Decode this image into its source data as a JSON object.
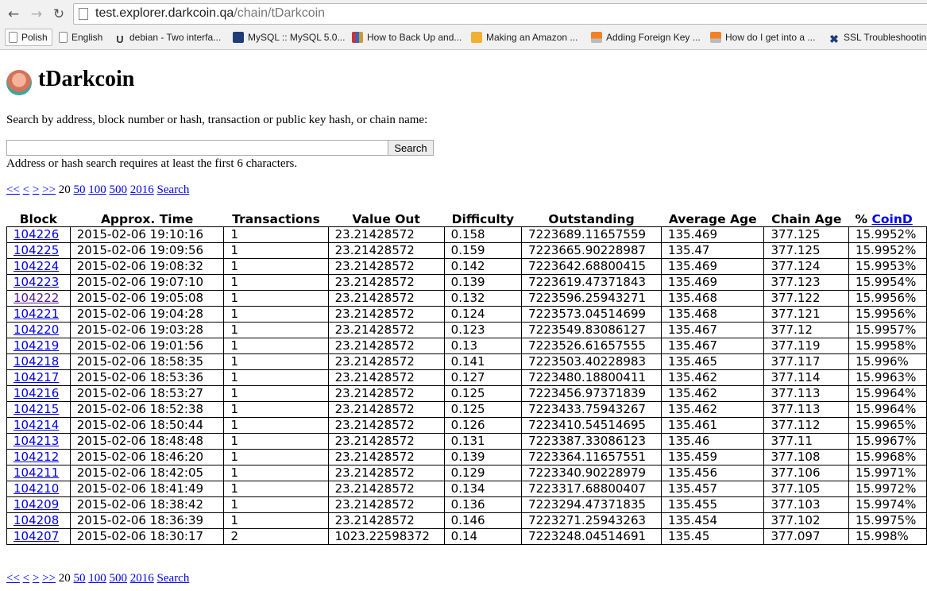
{
  "browser": {
    "url_host": "test.explorer.darkcoin.qa",
    "url_path": "/chain/tDarkcoin",
    "bookmarks": [
      {
        "label": "Polish",
        "icon": "document-icon"
      },
      {
        "label": "English",
        "icon": "document-icon"
      },
      {
        "label": "debian - Two interfa...",
        "icon": "ubuntu-icon"
      },
      {
        "label": "MySQL :: MySQL 5.0...",
        "icon": "mysql-icon"
      },
      {
        "label": "How to Back Up and...",
        "icon": "books-icon"
      },
      {
        "label": "Making an Amazon ...",
        "icon": "amazon-box-icon"
      },
      {
        "label": "Adding Foreign Key ...",
        "icon": "stackoverflow-icon"
      },
      {
        "label": "How do I get into a ...",
        "icon": "stackoverflow-icon"
      },
      {
        "label": "SSL Troubleshootin",
        "icon": "tools-icon"
      }
    ]
  },
  "page": {
    "title": "tDarkcoin",
    "search_description": "Search by address, block number or hash, transaction or public key hash, or chain name:",
    "search_input_value": "",
    "search_button": "Search",
    "search_hint": "Address or hash search requires at least the first 6 characters."
  },
  "pager": {
    "first": "<<",
    "prev": "<",
    "next": ">",
    "last": ">>",
    "current": "20",
    "sizes": [
      "50",
      "100",
      "500",
      "2016"
    ],
    "search": "Search"
  },
  "table": {
    "headers": [
      "Block",
      "Approx. Time",
      "Transactions",
      "Value Out",
      "Difficulty",
      "Outstanding",
      "Average Age",
      "Chain Age"
    ],
    "last_header_prefix": "% ",
    "last_header_link": "CoinD",
    "rows": [
      [
        "104226",
        "2015-02-06 19:10:16",
        "1",
        "23.21428572",
        "0.158",
        "7223689.11657559",
        "135.469",
        "377.125",
        "15.9952%"
      ],
      [
        "104225",
        "2015-02-06 19:09:56",
        "1",
        "23.21428572",
        "0.159",
        "7223665.90228987",
        "135.47",
        "377.125",
        "15.9952%"
      ],
      [
        "104224",
        "2015-02-06 19:08:32",
        "1",
        "23.21428572",
        "0.142",
        "7223642.68800415",
        "135.469",
        "377.124",
        "15.9953%"
      ],
      [
        "104223",
        "2015-02-06 19:07:10",
        "1",
        "23.21428572",
        "0.139",
        "7223619.47371843",
        "135.469",
        "377.123",
        "15.9954%"
      ],
      [
        "104222",
        "2015-02-06 19:05:08",
        "1",
        "23.21428572",
        "0.132",
        "7223596.25943271",
        "135.468",
        "377.122",
        "15.9956%"
      ],
      [
        "104221",
        "2015-02-06 19:04:28",
        "1",
        "23.21428572",
        "0.124",
        "7223573.04514699",
        "135.468",
        "377.121",
        "15.9956%"
      ],
      [
        "104220",
        "2015-02-06 19:03:28",
        "1",
        "23.21428572",
        "0.123",
        "7223549.83086127",
        "135.467",
        "377.12",
        "15.9957%"
      ],
      [
        "104219",
        "2015-02-06 19:01:56",
        "1",
        "23.21428572",
        "0.13",
        "7223526.61657555",
        "135.467",
        "377.119",
        "15.9958%"
      ],
      [
        "104218",
        "2015-02-06 18:58:35",
        "1",
        "23.21428572",
        "0.141",
        "7223503.40228983",
        "135.465",
        "377.117",
        "15.996%"
      ],
      [
        "104217",
        "2015-02-06 18:53:36",
        "1",
        "23.21428572",
        "0.127",
        "7223480.18800411",
        "135.462",
        "377.114",
        "15.9963%"
      ],
      [
        "104216",
        "2015-02-06 18:53:27",
        "1",
        "23.21428572",
        "0.125",
        "7223456.97371839",
        "135.462",
        "377.113",
        "15.9964%"
      ],
      [
        "104215",
        "2015-02-06 18:52:38",
        "1",
        "23.21428572",
        "0.125",
        "7223433.75943267",
        "135.462",
        "377.113",
        "15.9964%"
      ],
      [
        "104214",
        "2015-02-06 18:50:44",
        "1",
        "23.21428572",
        "0.126",
        "7223410.54514695",
        "135.461",
        "377.112",
        "15.9965%"
      ],
      [
        "104213",
        "2015-02-06 18:48:48",
        "1",
        "23.21428572",
        "0.131",
        "7223387.33086123",
        "135.46",
        "377.11",
        "15.9967%"
      ],
      [
        "104212",
        "2015-02-06 18:46:20",
        "1",
        "23.21428572",
        "0.139",
        "7223364.11657551",
        "135.459",
        "377.108",
        "15.9968%"
      ],
      [
        "104211",
        "2015-02-06 18:42:05",
        "1",
        "23.21428572",
        "0.129",
        "7223340.90228979",
        "135.456",
        "377.106",
        "15.9971%"
      ],
      [
        "104210",
        "2015-02-06 18:41:49",
        "1",
        "23.21428572",
        "0.134",
        "7223317.68800407",
        "135.457",
        "377.105",
        "15.9972%"
      ],
      [
        "104209",
        "2015-02-06 18:38:42",
        "1",
        "23.21428572",
        "0.136",
        "7223294.47371835",
        "135.455",
        "377.103",
        "15.9974%"
      ],
      [
        "104208",
        "2015-02-06 18:36:39",
        "1",
        "23.21428572",
        "0.146",
        "7223271.25943263",
        "135.454",
        "377.102",
        "15.9975%"
      ],
      [
        "104207",
        "2015-02-06 18:30:17",
        "2",
        "1023.22598372",
        "0.14",
        "7223248.04514691",
        "135.45",
        "377.097",
        "15.998%"
      ]
    ]
  },
  "colors": {
    "link": "#0000ee",
    "visited_link": "#551a8b"
  }
}
